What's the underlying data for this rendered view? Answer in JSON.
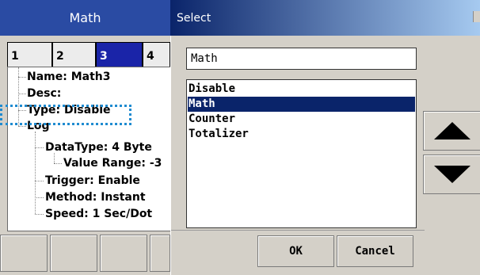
{
  "left": {
    "title": "Math",
    "tabs": [
      "1",
      "2",
      "3",
      "4"
    ],
    "active_tab": "3",
    "tree": {
      "name": "Name: Math3",
      "desc": "Desc:",
      "type": "Type: Disable",
      "log": "Log",
      "datatype": "DataType: 4 Byte",
      "value_range": "Value Range: -3",
      "trigger": "Trigger: Enable",
      "method": "Method: Instant",
      "speed": "Speed: 1 Sec/Dot"
    }
  },
  "dialog": {
    "title": "Select",
    "input_value": "Math",
    "options": [
      "Disable",
      "Math",
      "Counter",
      "Totalizer"
    ],
    "selected": "Math",
    "ok_label": "OK",
    "cancel_label": "Cancel",
    "up_icon": "triangle-up",
    "down_icon": "triangle-down"
  },
  "colors": {
    "left_title_bg": "#2a4ba3",
    "dialog_title_start": "#0a246a",
    "dialog_title_end": "#a6caf0",
    "selection": "#0a246a",
    "active_tab": "#1a24a8",
    "focus_outline": "#1f8bd0",
    "panel_bg": "#d4d0c8"
  }
}
